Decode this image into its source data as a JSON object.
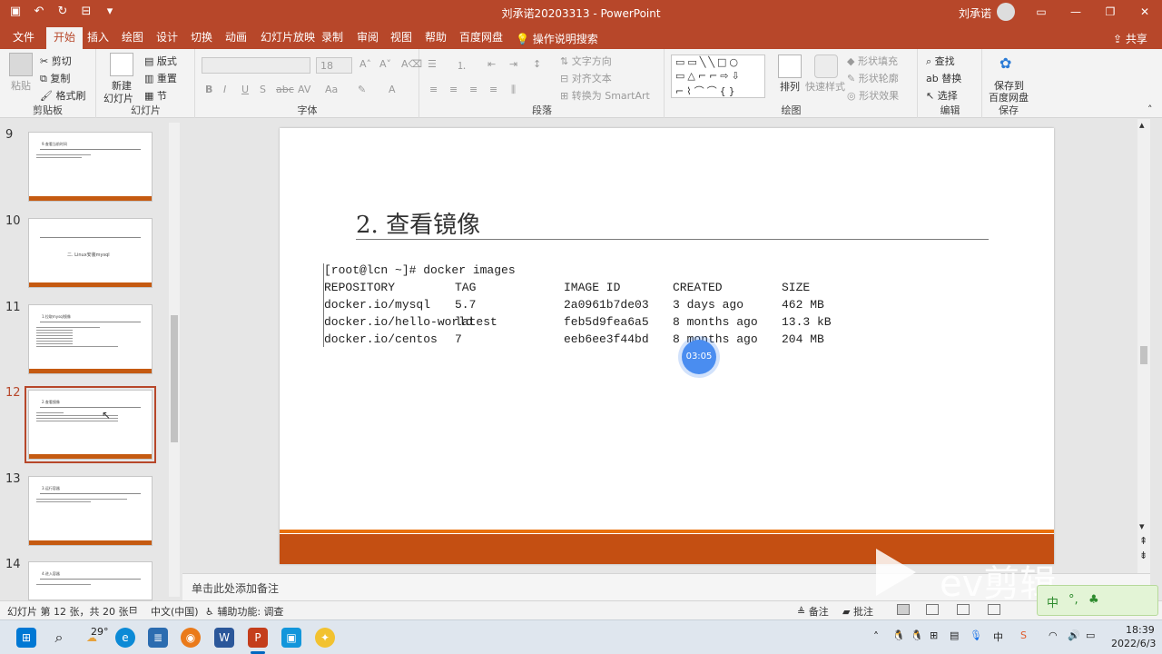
{
  "titlebar": {
    "title": "刘承诺20203313 - PowerPoint",
    "user": "刘承诺"
  },
  "menu_tabs": [
    "文件",
    "开始",
    "插入",
    "绘图",
    "设计",
    "切换",
    "动画",
    "幻灯片放映",
    "录制",
    "审阅",
    "视图",
    "帮助",
    "百度网盘"
  ],
  "menu_active": "开始",
  "tell_me": "操作说明搜索",
  "share": "共享",
  "ribbon": {
    "clipboard": {
      "paste": "粘贴",
      "cut": "剪切",
      "copy": "复制",
      "format_painter": "格式刷",
      "name": "剪贴板"
    },
    "slides": {
      "new_slide_1": "新建",
      "new_slide_2": "幻灯片",
      "layout": "版式",
      "reset": "重置",
      "section": "节",
      "name": "幻灯片"
    },
    "font": {
      "size": "18",
      "name": "字体"
    },
    "paragraph": {
      "text_direction": "文字方向",
      "align_text": "对齐文本",
      "smartart": "转换为 SmartArt",
      "name": "段落"
    },
    "drawing": {
      "arrange": "排列",
      "quick_styles": "快速样式",
      "shape_fill": "形状填充",
      "shape_outline": "形状轮廓",
      "shape_effects": "形状效果",
      "name": "绘图"
    },
    "editing": {
      "find": "查找",
      "replace": "替换",
      "select": "选择",
      "name": "编辑"
    },
    "save": {
      "label_1": "保存到",
      "label_2": "百度网盘",
      "name": "保存"
    }
  },
  "thumbnails": [
    {
      "num": "9",
      "title": "9.查看当前时间",
      "selected": false
    },
    {
      "num": "10",
      "title": "二. Linux安装mysql",
      "selected": false
    },
    {
      "num": "11",
      "title": "1.拉取mysql镜像",
      "selected": false
    },
    {
      "num": "12",
      "title": "2.查看镜像",
      "selected": true
    },
    {
      "num": "13",
      "title": "3.运行容器",
      "selected": false
    },
    {
      "num": "14",
      "title": "4.进入容器",
      "selected": false
    }
  ],
  "slide": {
    "title": "2. 查看镜像",
    "command": "[root@lcn ~]# docker images",
    "headers": [
      "REPOSITORY",
      "TAG",
      "IMAGE ID",
      "CREATED",
      "SIZE"
    ],
    "rows": [
      [
        "docker.io/mysql",
        "5.7",
        "2a0961b7de03",
        "3 days ago",
        "462 MB"
      ],
      [
        "docker.io/hello-world",
        "latest",
        "feb5d9fea6a5",
        "8 months ago",
        "13.3 kB"
      ],
      [
        "docker.io/centos",
        "7",
        "eeb6ee3f44bd",
        "8 months ago",
        "204 MB"
      ]
    ]
  },
  "timer": "03:05",
  "notes_placeholder": "单击此处添加备注",
  "status": {
    "slide_info": "幻灯片 第 12 张，共 20 张",
    "language": "中文(中国)",
    "accessibility": "辅助功能: 调查",
    "notes": "备注",
    "comments": "批注"
  },
  "watermark": "ev剪辑",
  "ime": {
    "mode": "中"
  },
  "taskbar": {
    "weather": "29°",
    "time": "18:39",
    "date": "2022/6/3"
  }
}
